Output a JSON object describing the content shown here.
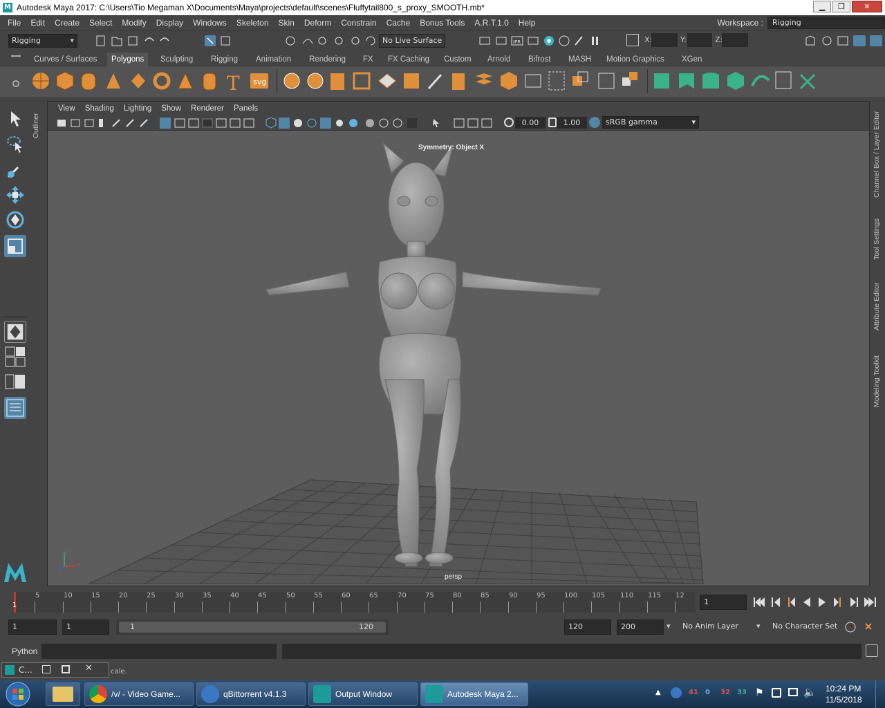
{
  "window": {
    "title": "Autodesk Maya 2017: C:\\Users\\Tio Megaman X\\Documents\\Maya\\projects\\default\\scenes\\Fluffytail800_s_proxy_SMOOTH.mb*",
    "logo_letter": "M",
    "min_glyph": "▁",
    "max_glyph": "❐",
    "close_glyph": "✕"
  },
  "menubar": {
    "items": [
      "File",
      "Edit",
      "Create",
      "Select",
      "Modify",
      "Display",
      "Windows",
      "Skeleton",
      "Skin",
      "Deform",
      "Constrain",
      "Cache",
      "Bonus Tools",
      "A.R.T.1.0",
      "Help"
    ],
    "workspace_label": "Workspace :",
    "workspace_value": "Rigging"
  },
  "statusline": {
    "menuset": "Rigging",
    "live_surface": "No Live Surface",
    "x_label": "X:",
    "y_label": "Y:",
    "z_label": "Z:"
  },
  "shelf": {
    "tabs": [
      "Curves / Surfaces",
      "Polygons",
      "Sculpting",
      "Rigging",
      "Animation",
      "Rendering",
      "FX",
      "FX Caching",
      "Custom",
      "Arnold",
      "Bifrost",
      "MASH",
      "Motion Graphics",
      "XGen"
    ],
    "active_tab": "Polygons",
    "svg_label": "svg",
    "text_label": "T"
  },
  "outliner_label": "Outliner",
  "viewport": {
    "menus": [
      "View",
      "Shading",
      "Lighting",
      "Show",
      "Renderer",
      "Panels"
    ],
    "exposure": "0.00",
    "gamma": "1.00",
    "color_space": "sRGB gamma",
    "symmetry_text": "Symmetry: Object X",
    "camera_label": "persp",
    "axis_x": "x",
    "axis_y": "y"
  },
  "right_tabs": [
    "Channel Box / Layer Editor",
    "Tool Settings",
    "Attribute Editor",
    "Modeling Toolkit"
  ],
  "timeslider": {
    "ticks": [
      "5",
      "10",
      "15",
      "20",
      "25",
      "30",
      "35",
      "40",
      "45",
      "50",
      "55",
      "60",
      "65",
      "70",
      "75",
      "80",
      "85",
      "90",
      "95",
      "100",
      "105",
      "110",
      "115",
      "12"
    ],
    "current_frame_marker": "1",
    "current_frame": "1"
  },
  "range": {
    "start_time": "1",
    "playback_start": "1",
    "slider_start": "1",
    "slider_end": "120",
    "playback_end": "120",
    "end_time": "200",
    "anim_layer": "No Anim Layer",
    "character_set": "No Character Set"
  },
  "cmdline": {
    "language": "Python"
  },
  "helpline": {
    "text": "cale.",
    "mini_window_title": "C..."
  },
  "taskbar": {
    "items": [
      {
        "label": "/v/ - Video Game...",
        "color": "#e24b3a"
      },
      {
        "label": "qBittorrent v4.1.3",
        "color": "#3b78c4"
      },
      {
        "label": "Output Window",
        "color": "#1d9a9a"
      },
      {
        "label": "Autodesk Maya 2...",
        "color": "#1d9a9a"
      }
    ],
    "time": "10:24 PM",
    "date": "11/5/2018",
    "tray_numbers": [
      "41",
      "0",
      "32",
      "33"
    ]
  },
  "colors": {
    "accent_blue": "#5285a6",
    "shelf_orange": "#e0903a",
    "shelf_green": "#3bb38a",
    "current_frame_red": "#c0392b"
  }
}
